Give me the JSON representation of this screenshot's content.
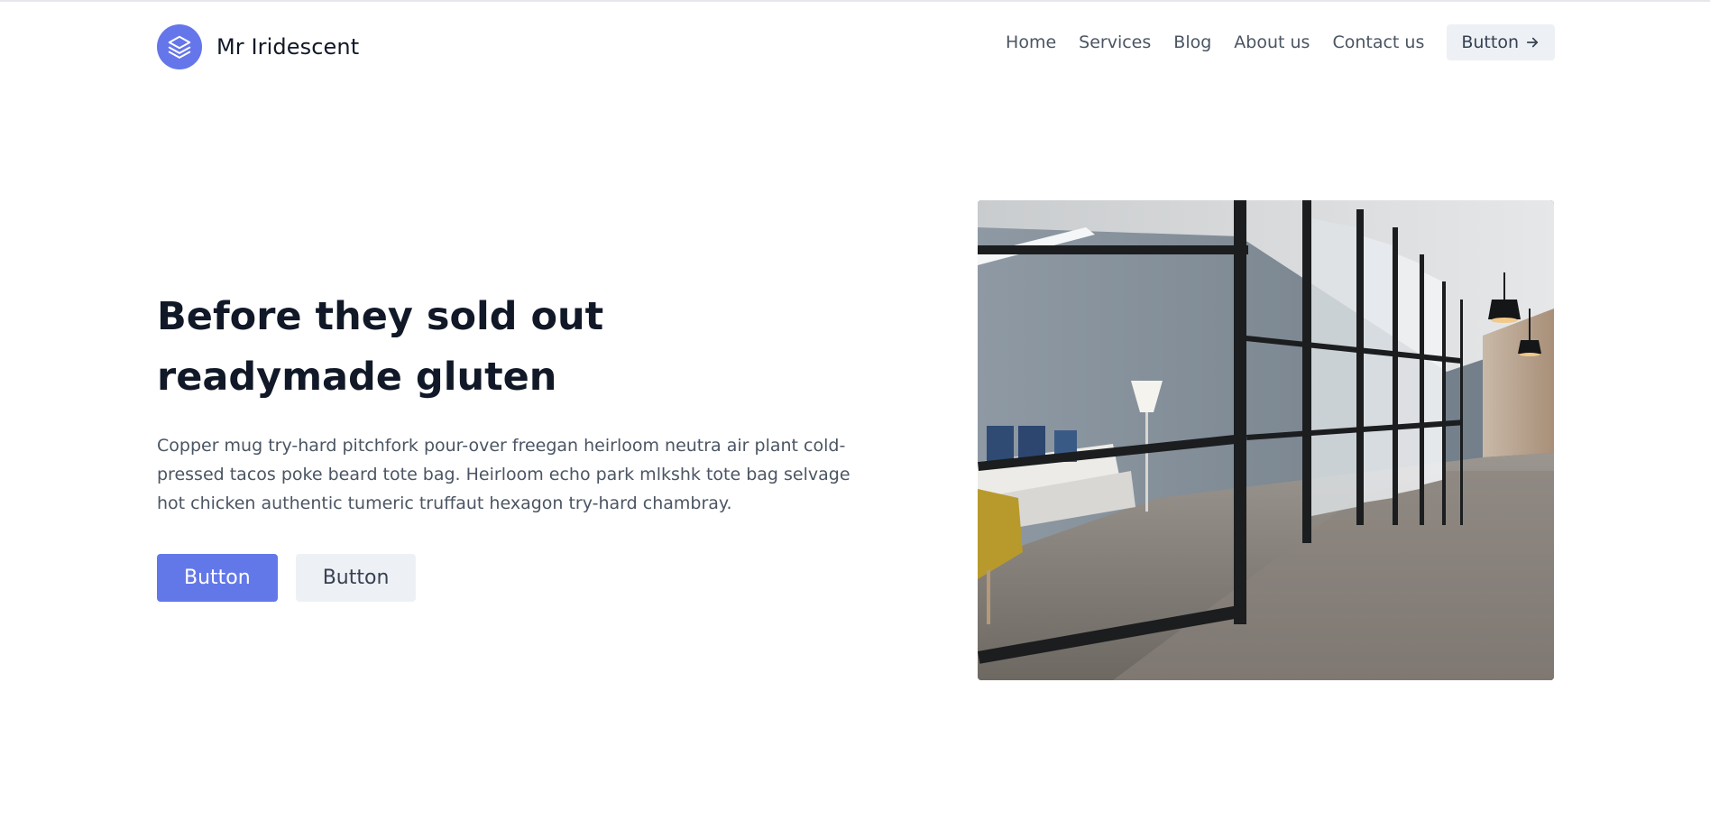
{
  "brand": {
    "name": "Mr Iridescent",
    "logo_icon": "layers-icon",
    "accent_color": "#6576ea"
  },
  "nav": {
    "links": [
      "Home",
      "Services",
      "Blog",
      "About us",
      "Contact us"
    ],
    "button_label": "Button",
    "button_icon": "arrow-right-icon"
  },
  "hero": {
    "title": "Before they sold out readymade gluten",
    "description": "Copper mug try-hard pitchfork pour-over freegan heirloom neutra air plant cold-pressed tacos poke beard tote bag. Heirloom echo park mlkshk tote bag selvage hot chicken authentic tumeric truffaut hexagon try-hard chambray.",
    "primary_button": "Button",
    "secondary_button": "Button",
    "image_subject": "office-corridor-photo"
  }
}
